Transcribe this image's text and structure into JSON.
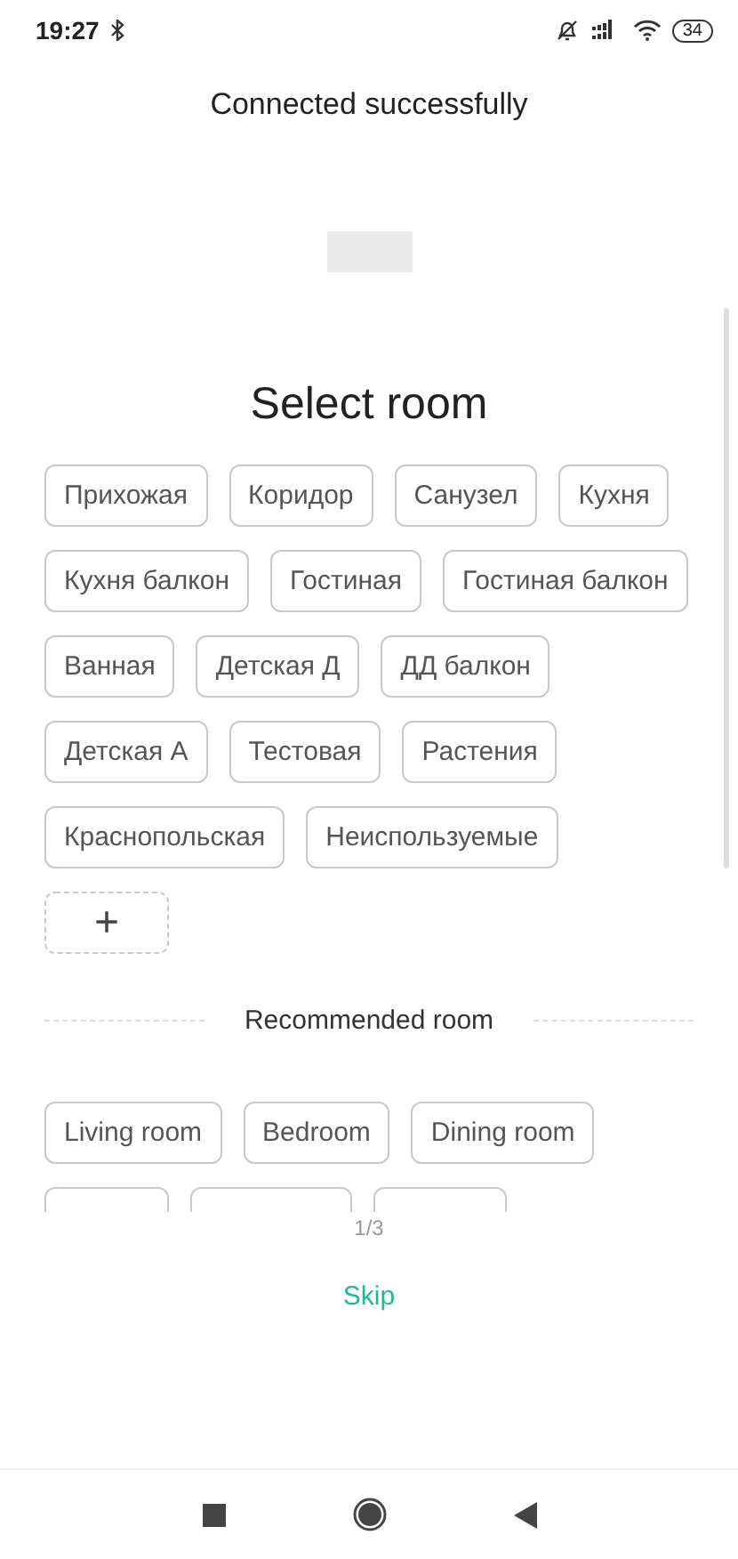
{
  "status_bar": {
    "time": "19:27",
    "battery": "34"
  },
  "header": {
    "title": "Connected successfully"
  },
  "heading": "Select room",
  "rooms": [
    {
      "label": "Прихожая",
      "kind": "room"
    },
    {
      "label": "Коридор",
      "kind": "room"
    },
    {
      "label": "Санузел",
      "kind": "room"
    },
    {
      "label": "Кухня",
      "kind": "room"
    },
    {
      "label": "Кухня балкон",
      "kind": "room"
    },
    {
      "label": "Гостиная",
      "kind": "room"
    },
    {
      "label": "Гостиная балкон",
      "kind": "room"
    },
    {
      "label": "Ванная",
      "kind": "room"
    },
    {
      "label": "Детская Д",
      "kind": "room"
    },
    {
      "label": "ДД балкон",
      "kind": "room"
    },
    {
      "label": "Детская А",
      "kind": "room"
    },
    {
      "label": "Тестовая",
      "kind": "room"
    },
    {
      "label": "Растения",
      "kind": "room"
    },
    {
      "label": "Краснопольская",
      "kind": "room"
    },
    {
      "label": "Неиспользуемые",
      "kind": "room"
    },
    {
      "label": "+",
      "kind": "add"
    }
  ],
  "recommended": {
    "title": "Recommended room",
    "chips": [
      {
        "label": "Living room",
        "kind": "room"
      },
      {
        "label": "Bedroom",
        "kind": "room"
      },
      {
        "label": "Dining room",
        "kind": "room"
      },
      {
        "kind": "cut"
      },
      {
        "kind": "cut"
      },
      {
        "kind": "cut"
      }
    ]
  },
  "pager": "1/3",
  "skip": "Skip"
}
